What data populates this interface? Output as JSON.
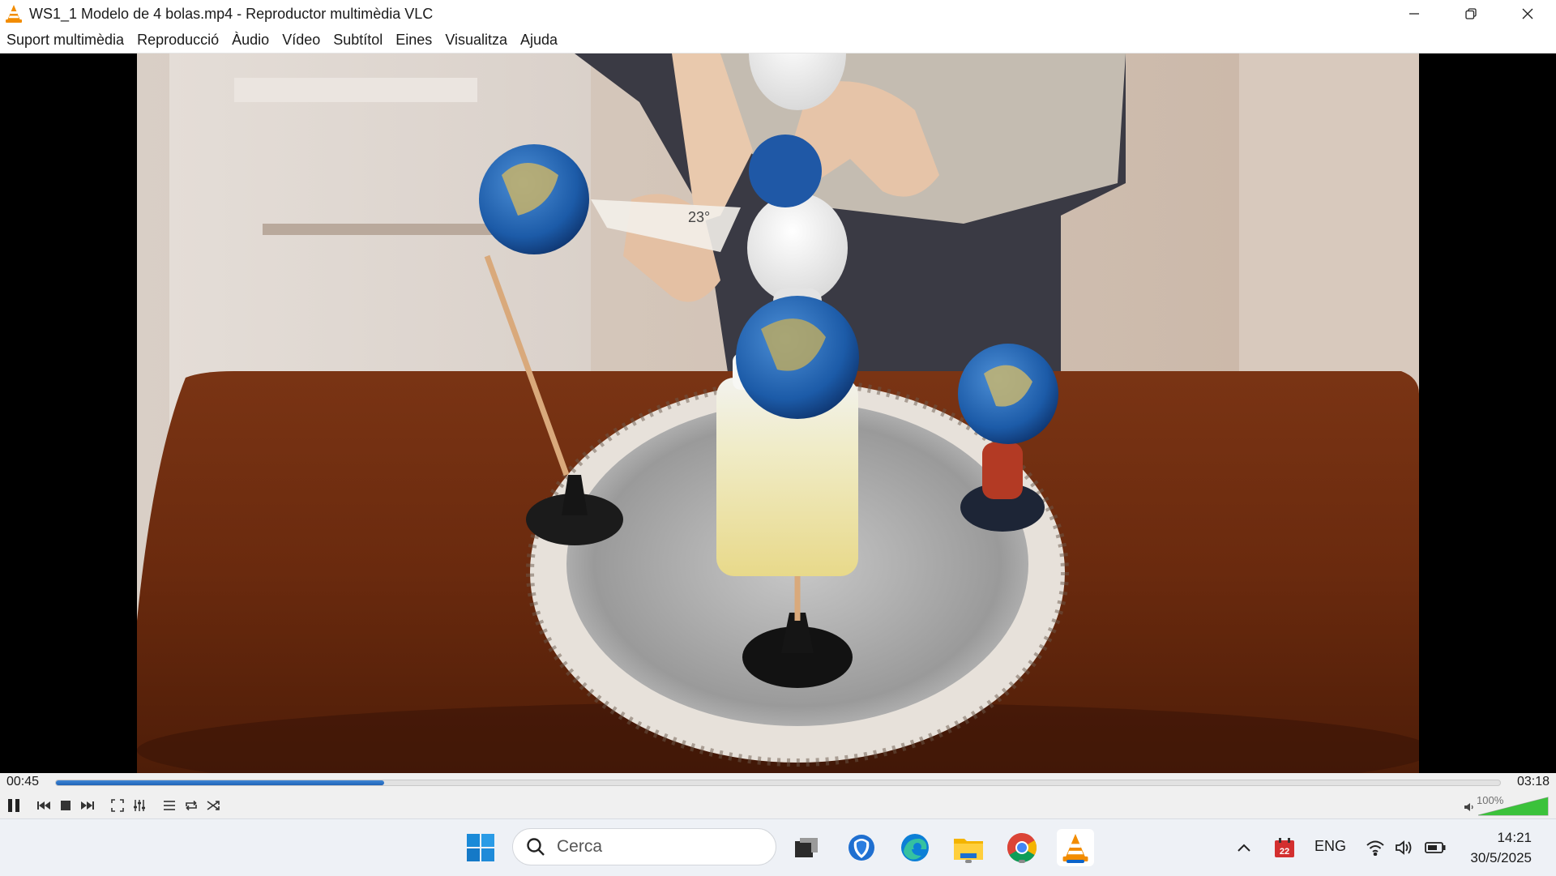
{
  "window": {
    "title": "WS1_1 Modelo de 4 bolas.mp4 - Reproductor multimèdia VLC"
  },
  "menu": [
    "Suport multimèdia",
    "Reproducció",
    "Àudio",
    "Vídeo",
    "Subtítol",
    "Eines",
    "Visualitza",
    "Ajuda"
  ],
  "video": {
    "annotation_label": "23°"
  },
  "player": {
    "elapsed": "00:45",
    "total": "03:18",
    "progress": 0.227,
    "volume_label": "100%",
    "volume_level": 1.0
  },
  "taskbar": {
    "search_placeholder": "Cerca",
    "language": "ENG",
    "calendar_badge": "22",
    "time": "14:21",
    "date": "30/5/2025"
  },
  "colors": {
    "accent": "#1f63b8",
    "vlc_orange": "#f28c00",
    "volume_green": "#3bc23b"
  }
}
